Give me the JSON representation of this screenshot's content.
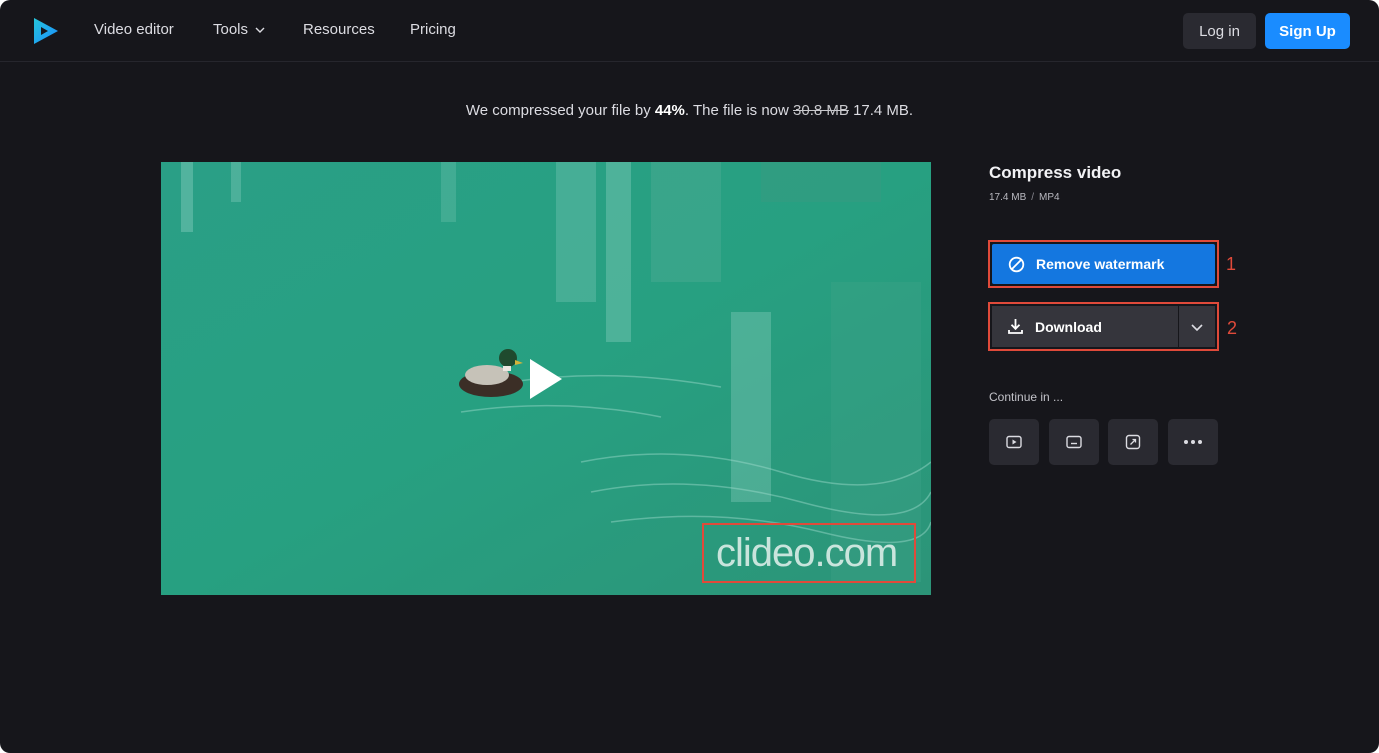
{
  "header": {
    "nav": [
      {
        "label": "Video editor"
      },
      {
        "label": "Tools"
      },
      {
        "label": "Resources"
      },
      {
        "label": "Pricing"
      }
    ],
    "login_label": "Log in",
    "signup_label": "Sign Up"
  },
  "message": {
    "prefix": "We compressed your file by ",
    "percent": "44%",
    "middle": ". The file is now ",
    "old_size": "30.8 MB",
    "new_size": "17.4 MB."
  },
  "video": {
    "watermark": "clideo.com"
  },
  "panel": {
    "title": "Compress video",
    "size": "17.4 MB",
    "separator": "/",
    "format": "MP4",
    "remove_watermark_label": "Remove watermark",
    "download_label": "Download",
    "continue_label": "Continue in ...",
    "annotations": [
      "1",
      "2"
    ]
  },
  "colors": {
    "background": "#16161b",
    "accent": "#1a8cff",
    "remove_button": "#1477e0",
    "annotation": "#e04a3a"
  }
}
